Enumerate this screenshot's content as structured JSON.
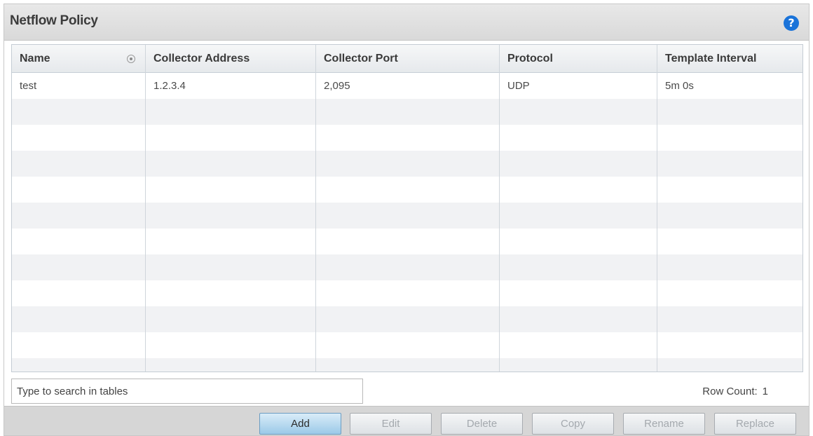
{
  "panel": {
    "title": "Netflow Policy",
    "help_icon": "question-circle-icon",
    "help_glyph": "?"
  },
  "table": {
    "columns": [
      "Name",
      "Collector Address",
      "Collector Port",
      "Protocol",
      "Template Interval"
    ],
    "rows": [
      [
        "test",
        "1.2.3.4",
        "2,095",
        "UDP",
        "5m 0s"
      ]
    ],
    "sort_icon": "sort-radio-icon"
  },
  "search": {
    "placeholder": "Type to search in tables"
  },
  "row_count": {
    "label": "Row Count:",
    "value": "1"
  },
  "buttons": {
    "add": "Add",
    "edit": "Edit",
    "delete": "Delete",
    "copy": "Copy",
    "rename": "Rename",
    "replace": "Replace"
  },
  "colors": {
    "accent_blue": "#1a73d9",
    "primary_button": "#9bc9e8",
    "row_alt": "#f1f2f4"
  }
}
